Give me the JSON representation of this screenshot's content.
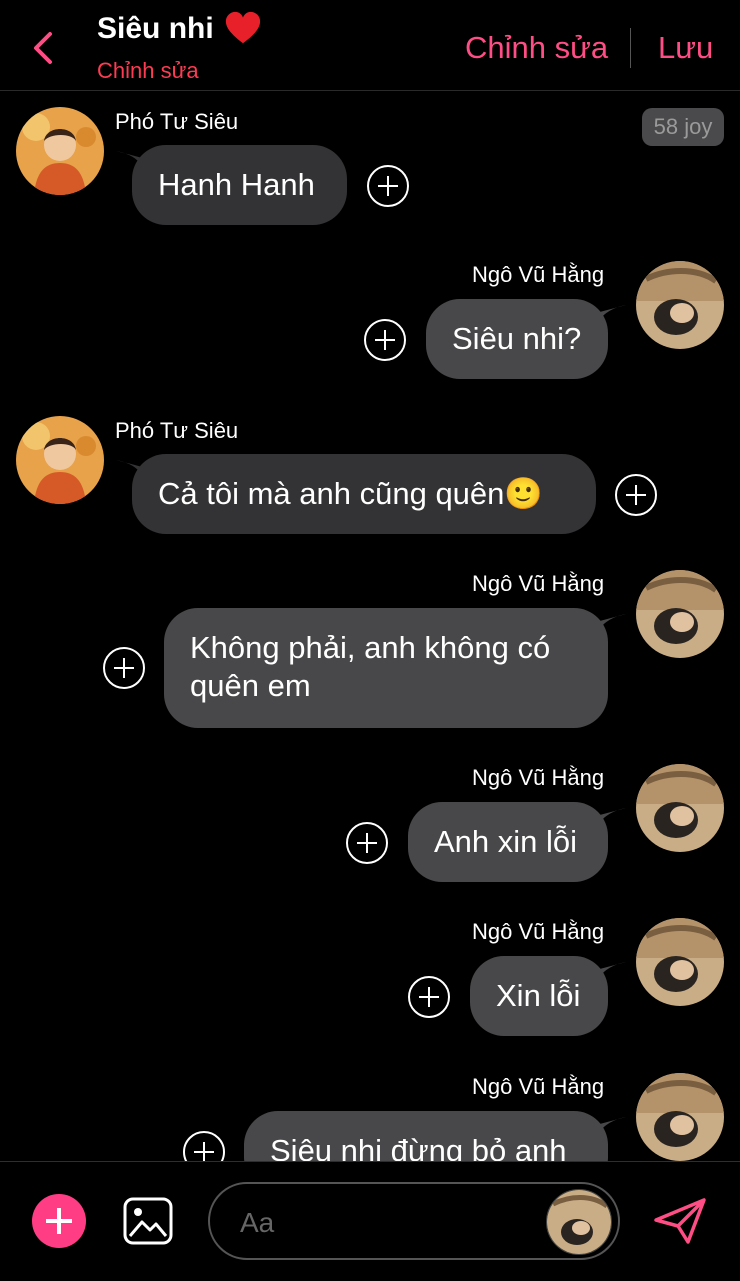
{
  "header": {
    "title": "Siêu nhi",
    "subtitle": "Chỉnh sửa",
    "edit_label": "Chỉnh sửa",
    "save_label": "Lưu",
    "accent_color": "#ff4d86"
  },
  "badge": "58 joy",
  "messages": [
    {
      "sender": "Phó Tư Siêu",
      "text": "Hanh Hanh",
      "side": "left"
    },
    {
      "sender": "Ngô Vũ Hằng",
      "text": "Siêu nhi?",
      "side": "right"
    },
    {
      "sender": "Phó Tư Siêu",
      "text": "Cả tôi mà anh cũng quên🙂",
      "side": "left"
    },
    {
      "sender": "Ngô Vũ Hằng",
      "text": "Không phải, anh không có quên em",
      "side": "right"
    },
    {
      "sender": "Ngô Vũ Hằng",
      "text": "Anh xin lỗi",
      "side": "right"
    },
    {
      "sender": "Ngô Vũ Hằng",
      "text": "Xin lỗi",
      "side": "right"
    },
    {
      "sender": "Ngô Vũ Hằng",
      "text": "Siêu nhi đừng bỏ anh",
      "side": "right"
    }
  ],
  "composer": {
    "placeholder": "Aa"
  }
}
